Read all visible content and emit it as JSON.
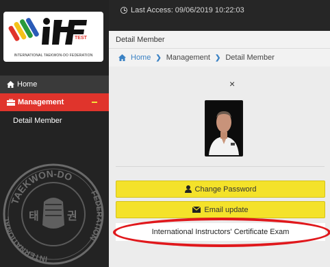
{
  "logo": {
    "brand": "ITF",
    "tag": "TEST",
    "caption": "INTERNATIONAL TAEKWON-DO FEDERATION"
  },
  "sidebar": {
    "items": [
      {
        "label": "Home",
        "icon": "home-icon"
      },
      {
        "label": "Management",
        "icon": "briefcase-icon"
      }
    ],
    "sub_item": "Detail Member",
    "emblem": {
      "top_text": "TAEKWON-DO",
      "left_text": "INTERNATIONAL",
      "right_text": "FEDERATION",
      "center_left": "태",
      "center_right": "권"
    }
  },
  "topbar": {
    "last_access": "Last Access: 09/06/2019 10:22:03"
  },
  "header": {
    "title": "Detail Member"
  },
  "breadcrumb": {
    "home": "Home",
    "section": "Management",
    "page": "Detail Member"
  },
  "content": {
    "close": "×",
    "change_password": "Change Password",
    "email_update": "Email update",
    "exam": "International Instructors' Certificate Exam"
  },
  "colors": {
    "accent_red": "#e0342c",
    "button_yellow": "#f4e22a",
    "link_blue": "#3b82c4",
    "annotation_red": "#e0181c"
  }
}
